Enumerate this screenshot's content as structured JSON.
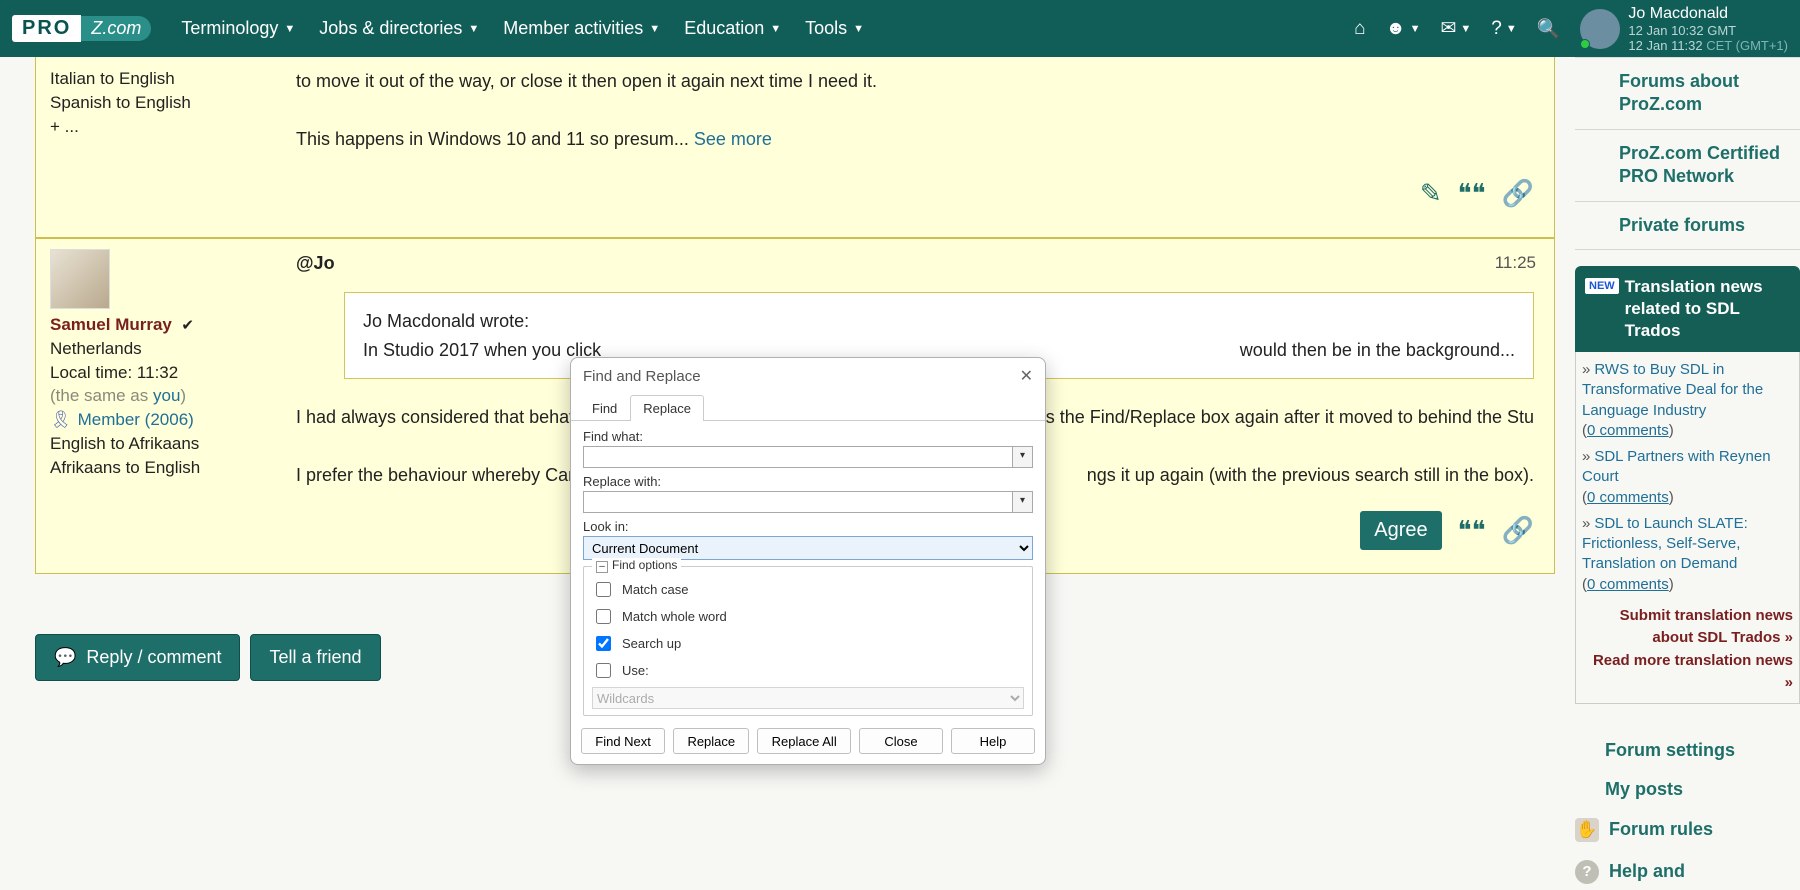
{
  "nav": {
    "menus": [
      "Terminology",
      "Jobs & directories",
      "Member activities",
      "Education",
      "Tools"
    ],
    "user": {
      "name": "Jo Macdonald",
      "time1": "12 Jan 10:32 GMT",
      "time2_prefix": "12 Jan 11:32 ",
      "time2_suffix": "CET (GMT+1)"
    }
  },
  "post1": {
    "lang1": "Italian to English",
    "lang2": "Spanish to English",
    "more": "+ ...",
    "body": "to move it out of the way, or close it then open it again next time I need it.",
    "body2": "This happens in Windows 10 and 11 so presum... ",
    "seemore": "See more"
  },
  "post2": {
    "username": "Samuel Murray",
    "location": "Netherlands",
    "localtime": "Local time: 11:32",
    "same_pre": "(the same as ",
    "same_link": "you",
    "same_post": ")",
    "ribbon": "🎗",
    "member": "Member (2006)",
    "lang1": "English to Afrikaans",
    "lang2": "Afrikaans to English",
    "subject": "@Jo",
    "time": "11:25",
    "quote_l1": "Jo Macdonald wrote:",
    "quote_l2": "In Studio 2017 when you click",
    "quote_l3_tail": "would then be in the background...",
    "body1_a": "I had always considered that behaviou",
    "body1_b": "ss the Find/Replace box again after it moved to behind the Stu",
    "body2_a": "I prefer the behaviour whereby Cance",
    "body2_b": "ngs it up again (with the previous search still in the box).",
    "agree": "Agree"
  },
  "buttons": {
    "reply": "Reply / comment",
    "tell": "Tell a friend"
  },
  "side": {
    "links": [
      "Forums about ProZ.com",
      "ProZ.com Certified PRO Network",
      "Private forums"
    ],
    "news_head": "Translation news related to SDL Trados",
    "new": "NEW",
    "items": [
      {
        "title": "RWS to Buy SDL in Transformative Deal for the Language Industry",
        "comments": "0  comments"
      },
      {
        "title": "SDL Partners with Reynen Court",
        "comments": "0  comments"
      },
      {
        "title": "SDL to Launch SLATE: Frictionless, Self-Serve, Translation on Demand",
        "comments": "0  comments"
      }
    ],
    "more1": "Submit translation news about SDL Trados »",
    "more2": "Read more translation news »",
    "links2a": "Forum settings",
    "links2b": "My posts",
    "links2c": "Forum rules",
    "links2d": "Help and"
  },
  "dialog": {
    "title": "Find and Replace",
    "tab_find": "Find",
    "tab_replace": "Replace",
    "find_what": "Find what:",
    "replace_with": "Replace with:",
    "look_in": "Look in:",
    "look_in_val": "Current Document",
    "options_legend": "Find options",
    "match_case": "Match case",
    "match_whole": "Match whole word",
    "search_up": "Search up",
    "use": "Use:",
    "use_val": "Wildcards",
    "btn_findnext": "Find Next",
    "btn_replace": "Replace",
    "btn_replaceall": "Replace All",
    "btn_close": "Close",
    "btn_help": "Help"
  }
}
